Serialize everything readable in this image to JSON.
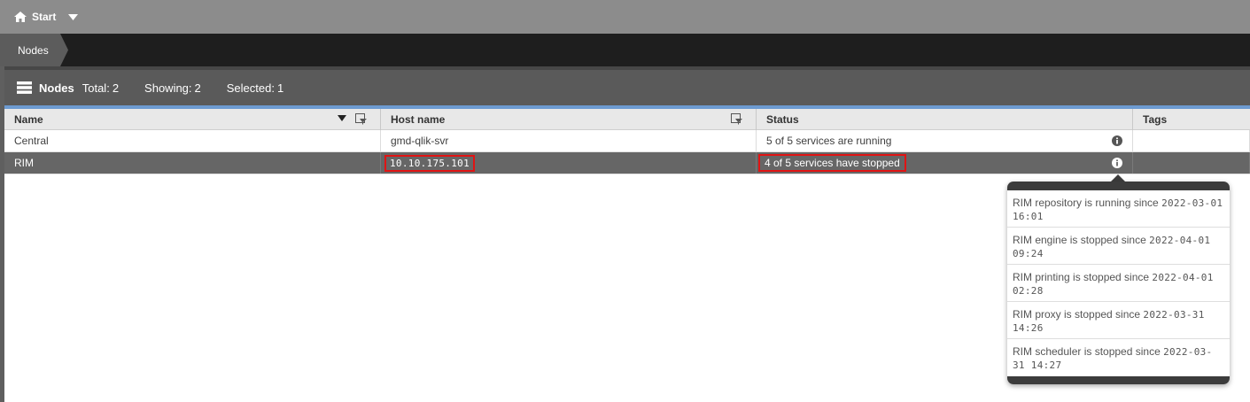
{
  "topbar": {
    "start_label": "Start",
    "home_icon": "home-icon",
    "caret_icon": "caret-down-icon"
  },
  "breadcrumb": {
    "label": "Nodes"
  },
  "panel": {
    "title": "Nodes",
    "total_label": "Total:",
    "total_value": "2",
    "showing_label": "Showing:",
    "showing_value": "2",
    "selected_label": "Selected:",
    "selected_value": "1"
  },
  "table": {
    "columns": [
      "Name",
      "Host name",
      "Status",
      "Tags"
    ],
    "rows": [
      {
        "name": "Central",
        "host": "gmd-qlik-svr",
        "status": "5 of 5 services are running",
        "tags": ""
      },
      {
        "name": "RIM",
        "host": "10.10.175.101",
        "status": "4 of 5 services have stopped",
        "tags": ""
      }
    ]
  },
  "popup": {
    "items": [
      {
        "text": "RIM repository is running since",
        "ts": "2022-03-01 16:01"
      },
      {
        "text": "RIM engine is stopped since",
        "ts": "2022-04-01 09:24"
      },
      {
        "text": "RIM printing is stopped since",
        "ts": "2022-04-01 02:28"
      },
      {
        "text": "RIM proxy is stopped since",
        "ts": "2022-03-31 14:26"
      },
      {
        "text": "RIM scheduler is stopped since",
        "ts": "2022-03-31 14:27"
      }
    ]
  },
  "colors": {
    "accent": "#6d9bd1",
    "highlight": "#e01414",
    "selected_row": "#666666"
  }
}
